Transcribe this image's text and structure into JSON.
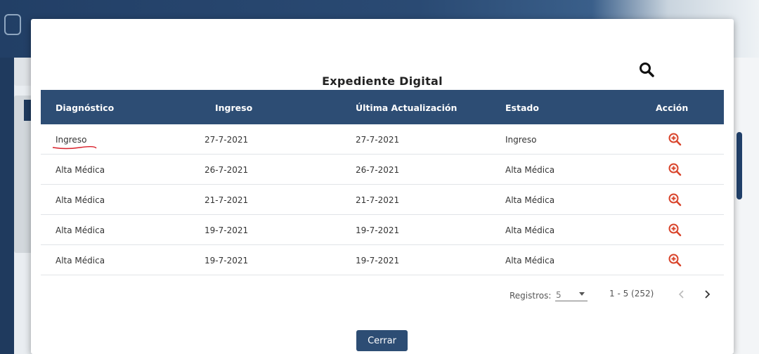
{
  "modal": {
    "title": "Expediente Digital",
    "columns": [
      "Diagnóstico",
      "Ingreso",
      "Última Actualización",
      "Estado",
      "Acción"
    ],
    "rows": [
      {
        "diagnostico": "Ingreso",
        "ingreso": "27-7-2021",
        "actualizacion": "27-7-2021",
        "estado": "Ingreso"
      },
      {
        "diagnostico": "Alta Médica",
        "ingreso": "26-7-2021",
        "actualizacion": "26-7-2021",
        "estado": "Alta Médica"
      },
      {
        "diagnostico": "Alta Médica",
        "ingreso": "21-7-2021",
        "actualizacion": "21-7-2021",
        "estado": "Alta Médica"
      },
      {
        "diagnostico": "Alta Médica",
        "ingreso": "19-7-2021",
        "actualizacion": "19-7-2021",
        "estado": "Alta Médica"
      },
      {
        "diagnostico": "Alta Médica",
        "ingreso": "19-7-2021",
        "actualizacion": "19-7-2021",
        "estado": "Alta Médica"
      }
    ],
    "pager": {
      "registros_label": "Registros:",
      "registros_value": "5",
      "range": "1 - 5 (252)"
    },
    "close_label": "Cerrar"
  },
  "icons": {
    "search": "search-icon",
    "action": "zoom-in-icon",
    "prev": "chevron-left-icon",
    "next": "chevron-right-icon"
  },
  "colors": {
    "header_bg": "#2d4d74",
    "action_icon": "#d9442b",
    "underline": "#d9202a"
  }
}
